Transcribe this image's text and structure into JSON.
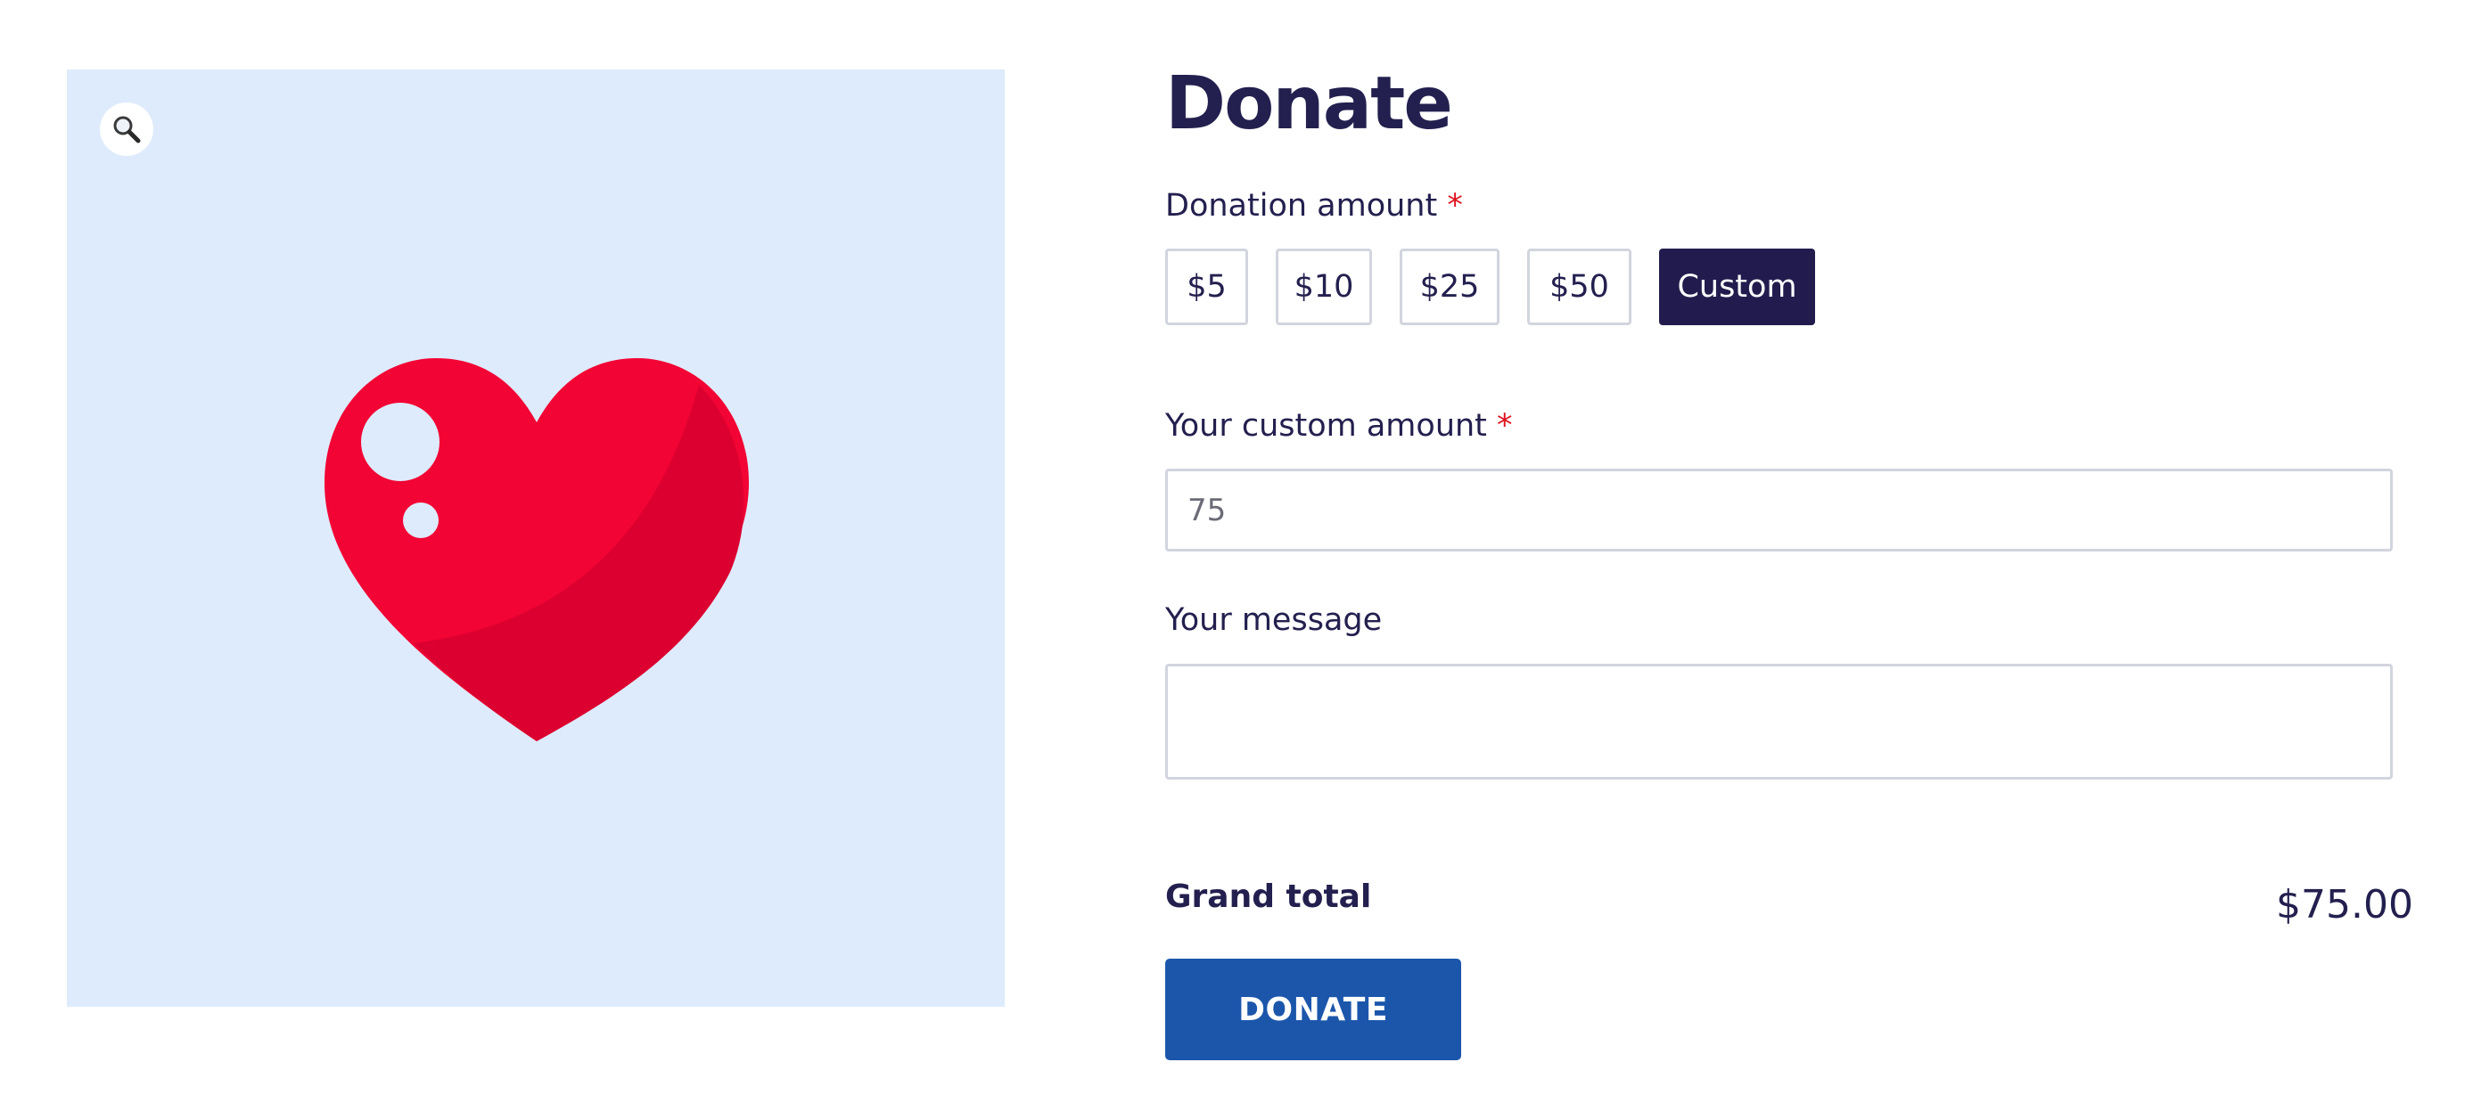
{
  "gallery": {
    "zoom_icon": "magnifier-icon",
    "image_icon": "heart-icon",
    "colors": {
      "background": "#deebfc",
      "heart": "#f20434",
      "heart_shade": "#dc0030"
    }
  },
  "product": {
    "title": "Donate",
    "amount_label": "Donation amount",
    "required_mark": "*",
    "amount_options": [
      "$5",
      "$10",
      "$25",
      "$50",
      "Custom"
    ],
    "selected_option": "Custom",
    "custom_amount_label": "Your custom amount",
    "custom_amount_value": "75",
    "message_label": "Your message",
    "message_value": "",
    "grand_total_label": "Grand total",
    "grand_total_value": "$75.00",
    "donate_button": "DONATE"
  },
  "colors": {
    "text": "#23204f",
    "selected_option_bg": "#221c4e",
    "button": "#1b56ab",
    "required": "#e0141f",
    "border": "#d2d5de"
  }
}
